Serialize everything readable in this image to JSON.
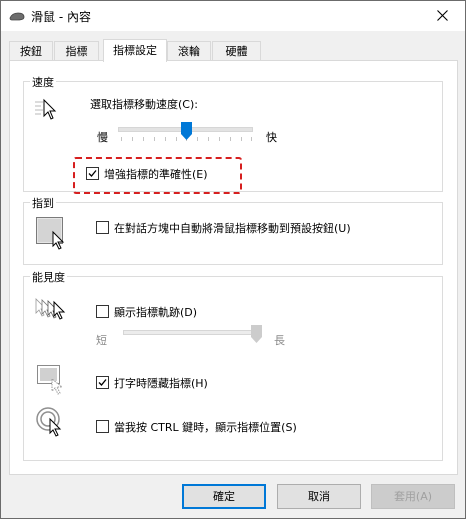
{
  "window": {
    "title": "滑鼠 - 內容"
  },
  "tabs": [
    {
      "label": "按鈕",
      "active": false
    },
    {
      "label": "指標",
      "active": false
    },
    {
      "label": "指標設定",
      "active": true
    },
    {
      "label": "滾輪",
      "active": false
    },
    {
      "label": "硬體",
      "active": false
    }
  ],
  "speed": {
    "group_title": "速度",
    "slider_label": "選取指標移動速度(C):",
    "min_label": "慢",
    "max_label": "快",
    "value_fraction": 0.5,
    "precision_label": "增強指標的準確性(E)",
    "precision_checked": true
  },
  "snap": {
    "group_title": "指到",
    "label": "在對話方塊中自動將滑鼠指標移動到預設按鈕(U)",
    "checked": false
  },
  "visibility": {
    "group_title": "能見度",
    "trails_label": "顯示指標軌跡(D)",
    "trails_checked": false,
    "short_label": "短",
    "long_label": "長",
    "trails_value_fraction": 1.0,
    "hide_label": "打字時隱藏指標(H)",
    "hide_checked": true,
    "ctrl_label": "當我按 CTRL 鍵時，顯示指標位置(S)",
    "ctrl_checked": false
  },
  "buttons": {
    "ok": "確定",
    "cancel": "取消",
    "apply": "套用(A)"
  },
  "colors": {
    "accent": "#0078d7",
    "highlight": "#d61f1f"
  }
}
